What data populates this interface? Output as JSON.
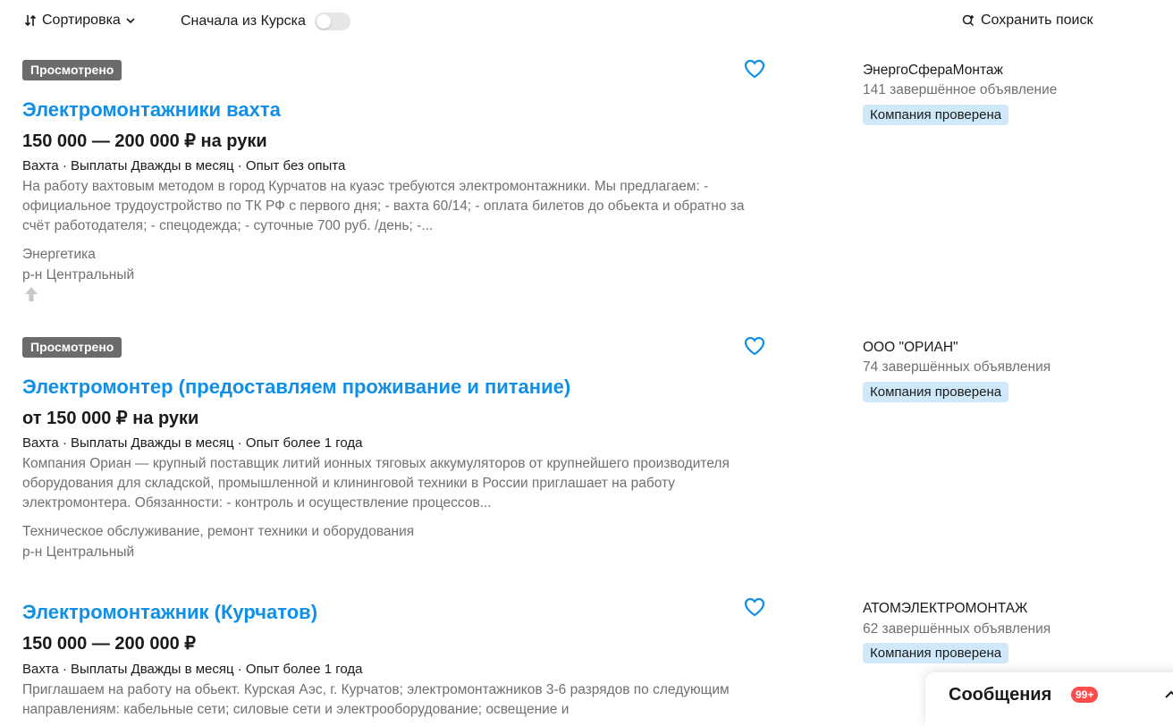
{
  "toolbar": {
    "sort_label": "Сортировка",
    "kursk_label": "Сначала из Курска",
    "kursk_toggle_on": false,
    "save_search_label": "Сохранить поиск"
  },
  "listings": [
    {
      "badge": "Просмотрено",
      "title": "Электромонтажники вахта",
      "salary": "150 000 — 200 000 ₽ на руки",
      "meta": "Вахта · Выплаты Дважды в месяц · Опыт без опыта",
      "description": "На работу вахтовым методом в город Курчатов на куаэс требуются электромонтажники. Мы предлагаем: - официальное трудоустройство по ТК РФ с первого дня; - вахта 60/14; - оплата билетов до обьекта и обратно за счёт работодателя; - спецодежда; - суточные 700 руб. /день; -...",
      "category": "Энергетика",
      "district": "р-н Центральный",
      "company": "ЭнергоСфераМонтаж",
      "company_count": "141 завершённое объявление",
      "verified": "Компания проверена"
    },
    {
      "badge": "Просмотрено",
      "title": "Электромонтер (предоставляем проживание и питание)",
      "salary": "от 150 000 ₽ на руки",
      "meta": "Вахта · Выплаты Дважды в месяц · Опыт более 1 года",
      "description": "Компания Ориан — крупный поставщик литий ионных тяговых аккумуляторов от крупнейшего производителя оборудования для складской, промышленной и клининговой техники в России приглашает на работу электромонтера. Обязанности: - контроль и осуществление процессов...",
      "category": "Техническое обслуживание, ремонт техники и оборудования",
      "district": "р-н Центральный",
      "company": "ООО \"ОРИАН\"",
      "company_count": "74 завершённых объявления",
      "verified": "Компания проверена"
    },
    {
      "title": "Электромонтажник (Курчатов)",
      "salary": "150 000 — 200 000 ₽",
      "meta": "Вахта · Выплаты Дважды в месяц · Опыт более 1 года",
      "description": "Приглашаем на работу на обьект. Курская Аэс, г. Курчатов; электромонтажников 3-6 разрядов по следующим направлениям: кабельные сети; силовые сети и электрооборудование; освещение и",
      "company": "АТОМЭЛЕКТРОМОНТАЖ",
      "company_count": "62 завершённых объявления",
      "verified": "Компания проверена"
    }
  ],
  "messages": {
    "label": "Сообщения",
    "count": "99+"
  },
  "colors": {
    "accent": "#0f8fe8",
    "badge_bg": "#6b6b6b",
    "verified_bg": "#cfe9fb",
    "counter_bg": "#ff4d4d"
  }
}
